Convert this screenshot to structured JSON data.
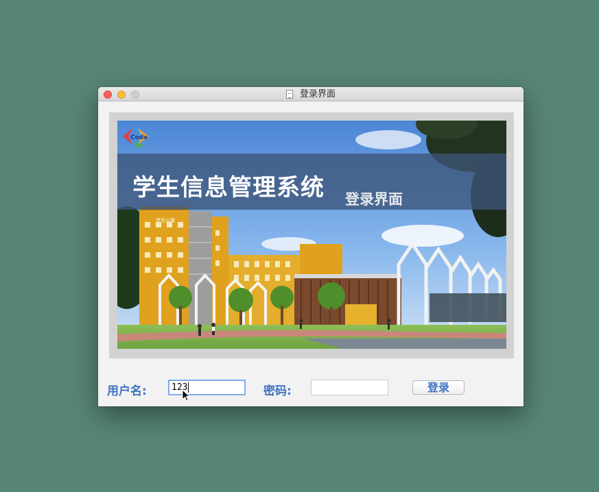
{
  "window": {
    "title": "登录界面"
  },
  "banner": {
    "logo_text": "Code",
    "headline": "学生信息管理系统",
    "subhead": "登录界面",
    "building_sign": "学生公寓"
  },
  "form": {
    "username_label": "用户名:",
    "username_value": "123",
    "password_label": "密码:",
    "password_value": "",
    "login_button": "登录"
  },
  "colors": {
    "desktop": "#578575",
    "label_blue": "#3f73c2",
    "focus_ring": "#7eacee"
  }
}
